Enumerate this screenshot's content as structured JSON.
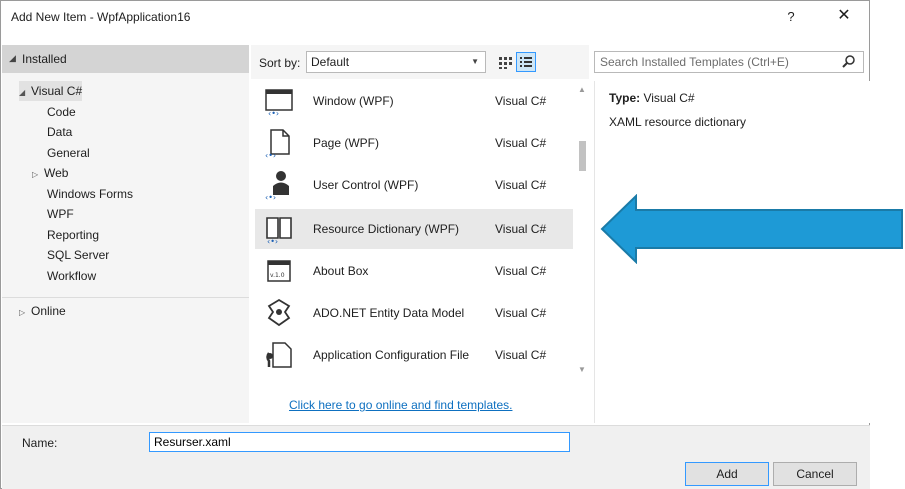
{
  "window": {
    "title": "Add New Item - WpfApplication16",
    "help_label": "?",
    "close_label": "✕"
  },
  "left_pane": {
    "installed_label": "Installed",
    "tree": [
      {
        "label": "Visual C#",
        "level": 0,
        "expander": "◢",
        "selected": true
      },
      {
        "label": "Code",
        "level": 1,
        "expander": ""
      },
      {
        "label": "Data",
        "level": 1,
        "expander": ""
      },
      {
        "label": "General",
        "level": 1,
        "expander": ""
      },
      {
        "label": "Web",
        "level": 1,
        "expander": "▷"
      },
      {
        "label": "Windows Forms",
        "level": 1,
        "expander": ""
      },
      {
        "label": "WPF",
        "level": 1,
        "expander": ""
      },
      {
        "label": "Reporting",
        "level": 1,
        "expander": ""
      },
      {
        "label": "SQL Server",
        "level": 1,
        "expander": ""
      },
      {
        "label": "Workflow",
        "level": 1,
        "expander": ""
      }
    ],
    "online_label": "Online"
  },
  "toolbar": {
    "sort_by_label": "Sort by:",
    "sort_value": "Default",
    "search_placeholder": "Search Installed Templates (Ctrl+E)"
  },
  "templates": [
    {
      "name": "Window (WPF)",
      "lang": "Visual C#",
      "icon": "window-icon"
    },
    {
      "name": "Page (WPF)",
      "lang": "Visual C#",
      "icon": "page-icon"
    },
    {
      "name": "User Control (WPF)",
      "lang": "Visual C#",
      "icon": "user-control-icon"
    },
    {
      "name": "Resource Dictionary (WPF)",
      "lang": "Visual C#",
      "icon": "resource-dictionary-icon",
      "selected": true
    },
    {
      "name": "About Box",
      "lang": "Visual C#",
      "icon": "about-box-icon"
    },
    {
      "name": "ADO.NET Entity Data Model",
      "lang": "Visual C#",
      "icon": "entity-model-icon"
    },
    {
      "name": "Application Configuration File",
      "lang": "Visual C#",
      "icon": "config-file-icon"
    }
  ],
  "online_link": "Click here to go online and find templates.",
  "details": {
    "type_label": "Type:",
    "type_value": "Visual C#",
    "description": "XAML resource dictionary"
  },
  "bottom": {
    "name_label": "Name:",
    "name_value": "Resurser.xaml",
    "add_label": "Add",
    "cancel_label": "Cancel"
  },
  "about_icon_text": "v.1.0",
  "colors": {
    "accent": "#3399ff",
    "link": "#0e70c0",
    "callout_arrow": "#1e9ad6",
    "callout_arrow_border": "#1a7ba8"
  }
}
